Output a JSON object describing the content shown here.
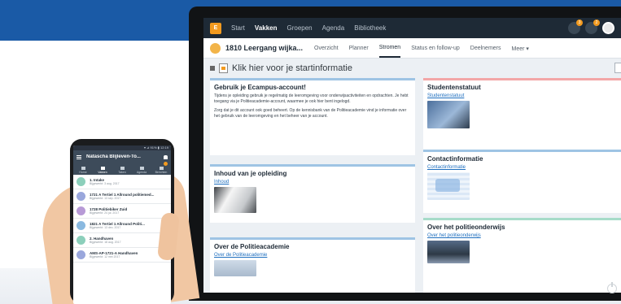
{
  "desktop": {
    "topnav": {
      "logo": "E",
      "items": [
        {
          "label": "Start",
          "active": false
        },
        {
          "label": "Vakken",
          "active": true
        },
        {
          "label": "Groepen",
          "active": false
        },
        {
          "label": "Agenda",
          "active": false
        },
        {
          "label": "Bibliotheek",
          "active": false
        }
      ],
      "badge_1": "3",
      "badge_2": "2"
    },
    "group": {
      "title": "1810 Leergang wijkа...",
      "tabs": [
        {
          "label": "Overzicht",
          "active": false
        },
        {
          "label": "Planner",
          "active": false
        },
        {
          "label": "Stromen",
          "active": true
        },
        {
          "label": "Status en follow-up",
          "active": false
        },
        {
          "label": "Deelnemers",
          "active": false
        },
        {
          "label": "Meer ▾",
          "active": false
        }
      ]
    },
    "startinfo": "Klik hier voor je startinformatie",
    "panels": {
      "ecampus": {
        "title": "Gebruik je Ecampus-account!",
        "p1": "Tijdens je opleiding gebruik je regelmatig de leeromgeving voor onderwijsactiviteiten en opdrachten. Je hebt toegang via je Politieacademie-account, waarmee je ook hier bent ingelogd.",
        "p2": "Zorg dat je dit account ook goed beheert. Op de kennisbank van de Politieacademie vind je informatie over het gebruik van de leeromgeving en het beheer van je account."
      },
      "statuut": {
        "title": "Studentenstatuut",
        "link": "Studentenstatuut"
      },
      "contact": {
        "title": "Contactinformatie",
        "link": "Contactinformatie"
      },
      "inhoud": {
        "title": "Inhoud van je opleiding",
        "link": "Inhoud"
      },
      "over": {
        "title": "Over de Politieacademie",
        "link": "Over de Politieacademie"
      },
      "onderwijs": {
        "title": "Over het politieonderwijs",
        "link": "Over het politieonderwijs"
      }
    }
  },
  "phone": {
    "status": "▾ ⊿ 91% ▮ 12:19",
    "title": "Natascha Blijleven-To...",
    "tabs": [
      {
        "label": "Home",
        "active": false
      },
      {
        "label": "Vakken",
        "active": true
      },
      {
        "label": "Taken",
        "active": false
      },
      {
        "label": "Agenda",
        "active": false
      },
      {
        "label": "Berichten",
        "active": false
      }
    ],
    "items": [
      {
        "name": "1. Intake",
        "sub": "Bijgewerkt: 3 aug. 2017",
        "color": "#8ccfbb",
        "count": ""
      },
      {
        "name": "1721 A Tertiel 1 Allround politiemed...",
        "sub": "Bijgewerkt: 13 sep. 2017",
        "color": "#9aa7dc",
        "count": ""
      },
      {
        "name": "1728 Politiebiker Zuid",
        "sub": "Bijgewerkt: 24 jul. 2017",
        "color": "#b79ad6",
        "count": ""
      },
      {
        "name": "1821 A Tertiel 1 Allround Politi...",
        "sub": "Bijgewerkt: 13 dec. 2017",
        "color": "#8ab9e0",
        "count": "2"
      },
      {
        "name": "2. Handhaven",
        "sub": "Bijgewerkt: 18 aug. 2017",
        "color": "#8ccfbb",
        "count": ""
      },
      {
        "name": "AMS-AP-1721-A Handhaven",
        "sub": "Bijgewerkt: 12 mei 2017",
        "color": "#9aa7dc",
        "count": ""
      }
    ]
  },
  "colors": {
    "brand_blue": "#1a5aa6",
    "nav_dark": "#1e2a36",
    "accent_orange": "#f29a1f"
  }
}
